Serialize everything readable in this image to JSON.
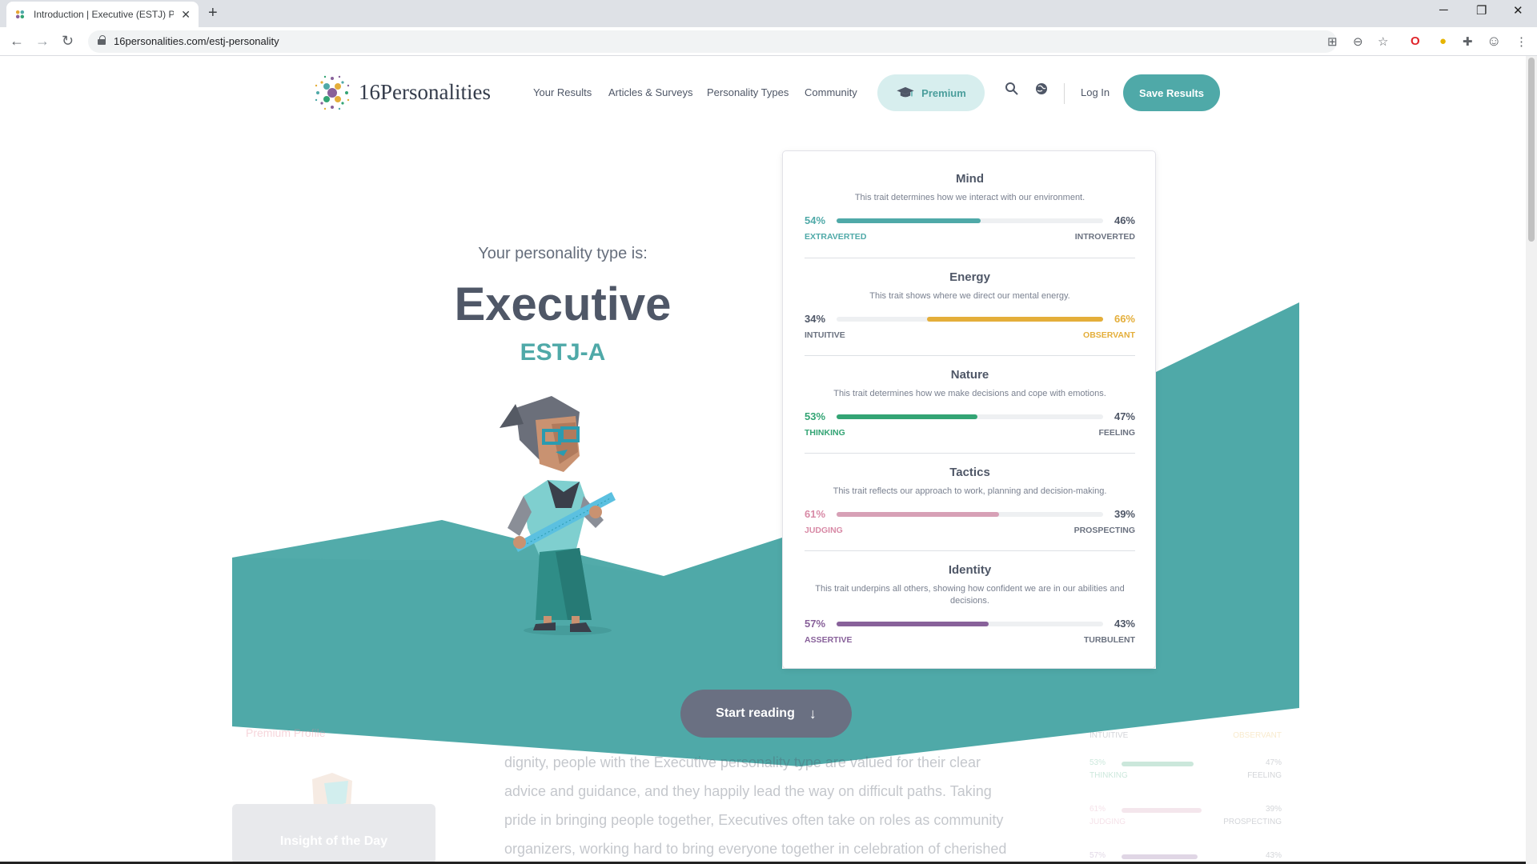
{
  "browser": {
    "tab_title": "Introduction | Executive (ESTJ) Pe",
    "url": "16personalities.com/estj-personality",
    "tab_close": "✕",
    "new_tab": "+",
    "win_minimize": "─",
    "win_restore": "❐",
    "win_close": "✕",
    "back": "←",
    "forward": "→",
    "reload": "↻"
  },
  "header": {
    "logo_text": "16Personalities",
    "nav": [
      "Your Results",
      "Articles & Surveys",
      "Personality Types",
      "Community"
    ],
    "premium_label": "Premium",
    "login_label": "Log In",
    "save_label": "Save Results"
  },
  "hero": {
    "intro": "Your personality type is:",
    "type_name": "Executive",
    "type_code": "ESTJ-A",
    "start_reading": "Start reading",
    "start_arrow": "↓"
  },
  "traits": [
    {
      "title": "Mind",
      "desc": "This trait determines how we interact with our environment.",
      "left_pct": "54%",
      "right_pct": "46%",
      "left_label": "EXTRAVERTED",
      "right_label": "INTROVERTED",
      "value": 54,
      "side": "left",
      "color": "#4fa9a8"
    },
    {
      "title": "Energy",
      "desc": "This trait shows where we direct our mental energy.",
      "left_pct": "34%",
      "right_pct": "66%",
      "left_label": "INTUITIVE",
      "right_label": "OBSERVANT",
      "value": 66,
      "side": "right",
      "color": "#e4ae3a"
    },
    {
      "title": "Nature",
      "desc": "This trait determines how we make decisions and cope with emotions.",
      "left_pct": "53%",
      "right_pct": "47%",
      "left_label": "THINKING",
      "right_label": "FEELING",
      "value": 53,
      "side": "left",
      "color": "#33a474"
    },
    {
      "title": "Tactics",
      "desc": "This trait reflects our approach to work, planning and decision-making.",
      "left_pct": "61%",
      "right_pct": "39%",
      "left_label": "JUDGING",
      "right_label": "PROSPECTING",
      "value": 61,
      "side": "left",
      "color": "#d7a0b6"
    },
    {
      "title": "Identity",
      "desc": "This trait underpins all others, showing how confident we are in our abilities and decisions.",
      "left_pct": "57%",
      "right_pct": "43%",
      "left_label": "ASSERTIVE",
      "right_label": "TURBULENT",
      "value": 57,
      "side": "left",
      "color": "#88619a"
    }
  ],
  "below": {
    "premium_profile": "Premium Profile",
    "insight": "Insight of the Day",
    "body_lines": [
      "dignity, people with the Executive personality type are valued for their clear",
      "advice and guidance, and they happily lead the way on difficult paths. Taking",
      "pride in bringing people together, Executives often take on roles as community",
      "organizers, working hard to bring everyone together in celebration of cherished"
    ]
  },
  "colors": {
    "teal": "#4fa9a8",
    "slate": "#4f5767",
    "button_gray": "#6a7082"
  }
}
